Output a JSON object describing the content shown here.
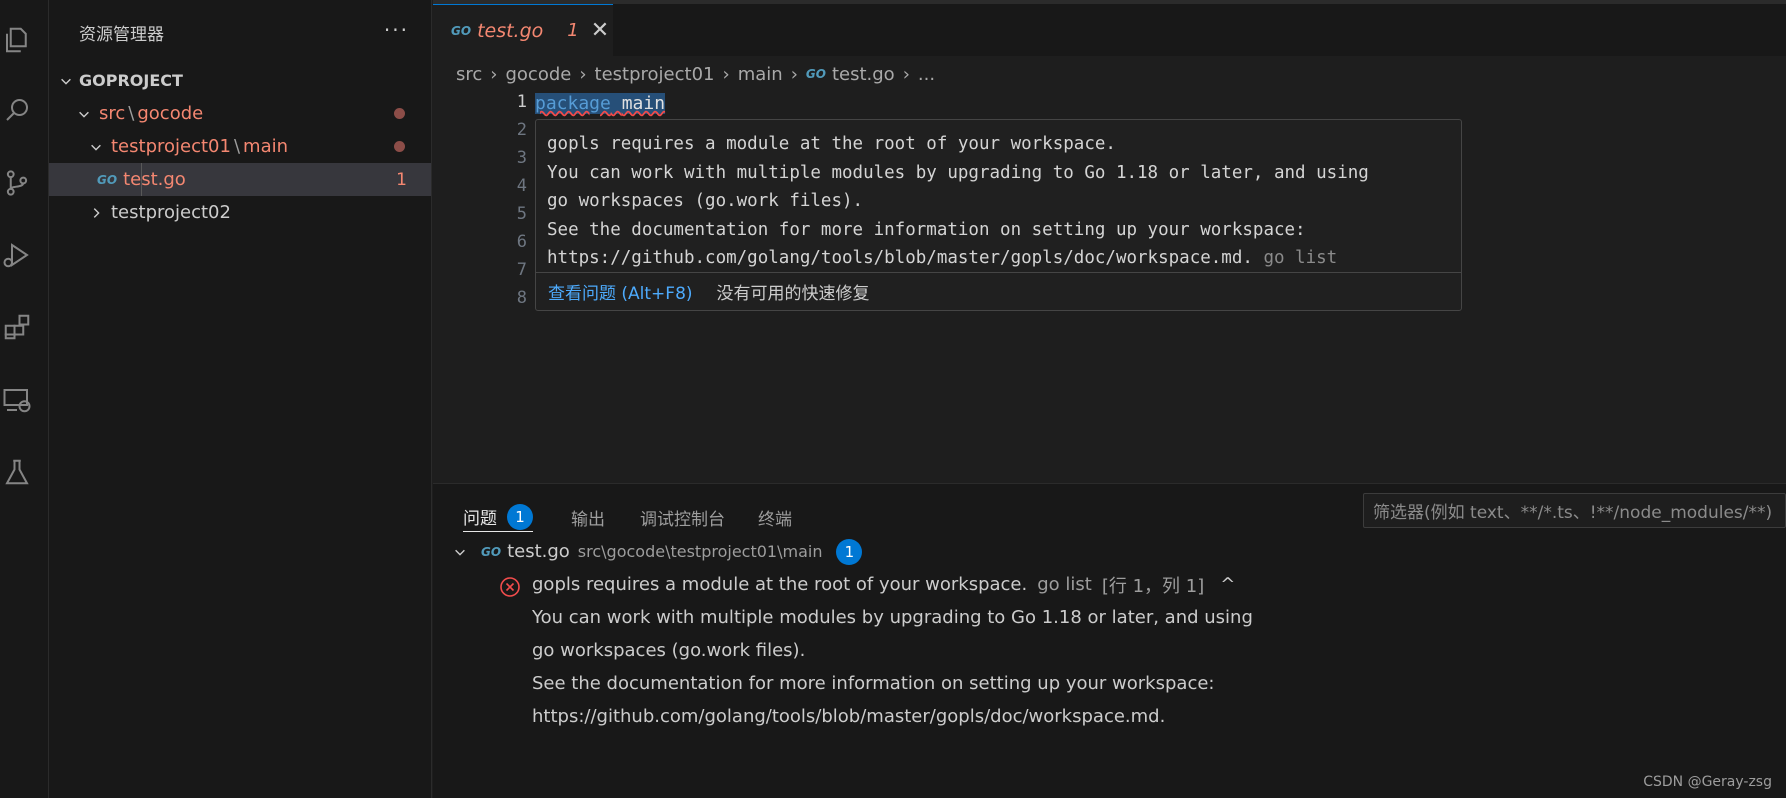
{
  "sidebar": {
    "title": "资源管理器",
    "more": "···",
    "root": "GOPROJECT",
    "items": [
      {
        "a": "src",
        "b": "gocode"
      },
      {
        "a": "testproject01",
        "b": "main"
      },
      {
        "file": "test.go",
        "count": "1",
        "icon": "GO"
      },
      {
        "label": "testproject02"
      }
    ],
    "sep": "\\"
  },
  "tab": {
    "icon": "GO",
    "name": "test.go",
    "count": "1",
    "close": "✕"
  },
  "breadcrumb": {
    "items": [
      "src",
      "gocode",
      "testproject01",
      "main",
      "test.go",
      "..."
    ],
    "sep": "›",
    "icon": "GO"
  },
  "editor": {
    "line_numbers": [
      "1",
      "2",
      "3",
      "4",
      "5",
      "6",
      "7",
      "8"
    ],
    "code_keyword": "package",
    "code_ident": "main"
  },
  "hover": {
    "lines": [
      "gopls requires a module at the root of your workspace.",
      "You can work with multiple modules by upgrading to Go 1.18 or later, and using",
      "go workspaces (go.work files).",
      "See the documentation for more information on setting up your workspace:",
      "https://github.com/golang/tools/blob/master/gopls/doc/workspace.md."
    ],
    "source": "go list",
    "view_problem": "查看问题 (Alt+F8)",
    "no_fix": "没有可用的快速修复"
  },
  "panel": {
    "tabs": [
      "问题",
      "输出",
      "调试控制台",
      "终端"
    ],
    "problems_count": "1",
    "filter_placeholder": "筛选器(例如 text、**/*.ts、!**/node_modules/**)",
    "file": {
      "icon": "GO",
      "name": "test.go",
      "path": "src\\gocode\\testproject01\\main",
      "count": "1"
    },
    "error": {
      "message": "gopls requires a module at the root of your workspace.",
      "source": "go list",
      "location": "[行 1，列 1]",
      "caret": "^",
      "detail": [
        "You can work with multiple modules by upgrading to Go 1.18 or later, and using",
        "go workspaces (go.work files).",
        "See the documentation for more information on setting up your workspace:",
        "https://github.com/golang/tools/blob/master/gopls/doc/workspace.md."
      ]
    }
  },
  "watermark": "CSDN @Geray-zsg",
  "colors": {
    "error": "#f48771",
    "accent": "#0078d4",
    "keyword": "#569cd6",
    "link": "#4daafc"
  }
}
